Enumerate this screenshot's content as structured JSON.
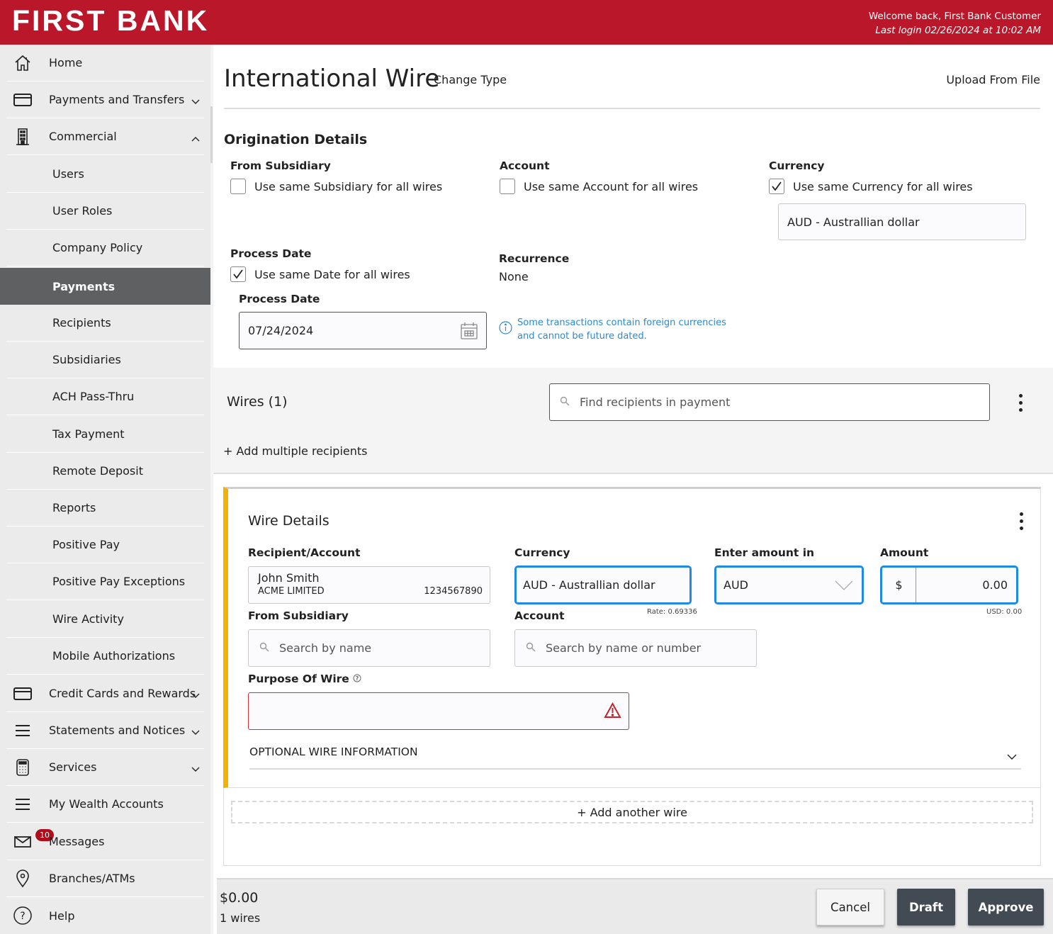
{
  "header": {
    "logo": "FIRST BANK",
    "welcome": "Welcome back, First Bank Customer",
    "last_login": "Last login 02/26/2024 at 10:02 AM"
  },
  "sidebar": {
    "items": [
      {
        "label": "Home",
        "icon": "home-icon"
      },
      {
        "label": "Payments and Transfers",
        "icon": "card-icon",
        "chevron": "down"
      },
      {
        "label": "Commercial",
        "icon": "building-icon",
        "chevron": "up"
      },
      {
        "label": "Users"
      },
      {
        "label": "User Roles"
      },
      {
        "label": "Company Policy"
      },
      {
        "label": "Payments",
        "active": true
      },
      {
        "label": "Recipients"
      },
      {
        "label": "Subsidiaries"
      },
      {
        "label": "ACH Pass-Thru"
      },
      {
        "label": "Tax Payment"
      },
      {
        "label": "Remote Deposit"
      },
      {
        "label": "Reports"
      },
      {
        "label": "Positive Pay"
      },
      {
        "label": "Positive Pay Exceptions"
      },
      {
        "label": "Wire Activity"
      },
      {
        "label": "Mobile Authorizations"
      },
      {
        "label": "Credit Cards and Rewards",
        "icon": "card-icon",
        "chevron": "down"
      },
      {
        "label": "Statements and Notices",
        "icon": "menu-lines-icon",
        "chevron": "down"
      },
      {
        "label": "Services",
        "icon": "calculator-icon",
        "chevron": "down"
      },
      {
        "label": "My Wealth Accounts",
        "icon": "menu-lines-icon"
      },
      {
        "label": "Messages",
        "icon": "mail-icon",
        "badge": "10"
      },
      {
        "label": "Branches/ATMs",
        "icon": "location-pin-icon"
      },
      {
        "label": "Help",
        "icon": "help-circle-icon"
      }
    ]
  },
  "page": {
    "title": "International Wire",
    "change_type": "Change Type",
    "upload": "Upload From File"
  },
  "origination": {
    "title": "Origination Details",
    "subsidiary_label": "From Subsidiary",
    "subsidiary_cb": "Use same Subsidiary for all wires",
    "subsidiary_checked": false,
    "account_label": "Account",
    "account_cb": "Use same Account for all wires",
    "account_checked": false,
    "currency_label": "Currency",
    "currency_cb": "Use same Currency for all wires",
    "currency_checked": true,
    "currency_value": "AUD - Australlian dollar",
    "process_date_label": "Process Date",
    "process_date_cb": "Use same Date for all wires",
    "process_date_checked": true,
    "process_date_field_label": "Process Date",
    "process_date_value": "07/24/2024",
    "recurrence_label": "Recurrence",
    "recurrence_value": "None",
    "info_line1": "Some transactions contain foreign currencies",
    "info_line2": "and cannot be future dated."
  },
  "wires": {
    "title": "Wires (1)",
    "search_placeholder": "Find recipients in payment",
    "add_multiple": "+ Add multiple recipients"
  },
  "wire_details": {
    "title": "Wire Details",
    "recipient_label": "Recipient/Account",
    "recipient_name": "John Smith",
    "recipient_company": "ACME LIMITED",
    "recipient_account": "1234567890",
    "currency_label": "Currency",
    "currency_value": "AUD - Australlian dollar",
    "rate": "Rate: 0.69336",
    "enter_amount_label": "Enter amount in",
    "enter_amount_value": "AUD",
    "amount_label": "Amount",
    "amount_symbol": "$",
    "amount_value": "0.00",
    "usd_amount": "USD: 0.00",
    "subsidiary_label": "From Subsidiary",
    "subsidiary_placeholder": "Search by name",
    "account_label": "Account",
    "account_placeholder": "Search by name or number",
    "purpose_label": "Purpose Of Wire",
    "purpose_value": "",
    "optional_info": "OPTIONAL WIRE INFORMATION",
    "add_another": "+ Add another wire"
  },
  "footer": {
    "total": "$0.00",
    "count": "1 wires",
    "cancel": "Cancel",
    "draft": "Draft",
    "approve": "Approve"
  },
  "colors": {
    "brand": "#bb172b",
    "focus": "#1f8ae6",
    "error": "#d1313b",
    "accent_bar": "#f2b106",
    "info": "#2a8ad0"
  }
}
